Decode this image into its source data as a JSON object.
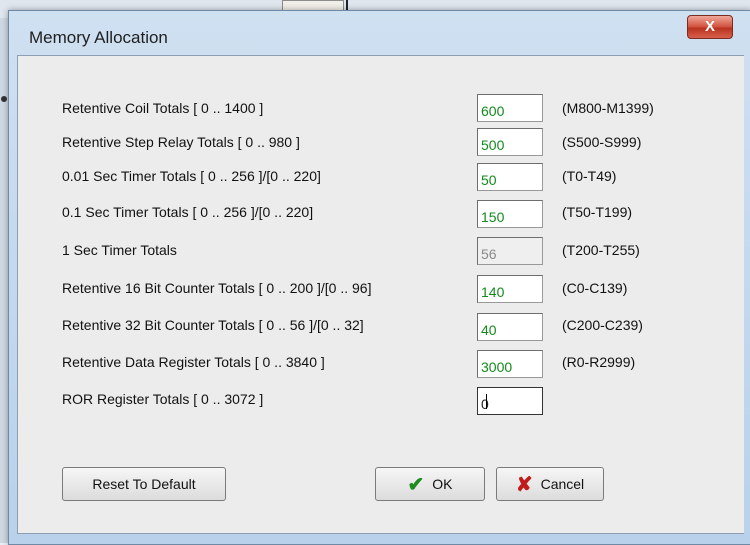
{
  "window": {
    "title": "Memory Allocation",
    "close_label": "X"
  },
  "rows": [
    {
      "label": "Retentive Coil Totals [ 0 .. 1400 ]",
      "value": "600",
      "range": "(M800-M1399)"
    },
    {
      "label": "Retentive Step Relay Totals [ 0 .. 980 ]",
      "value": "500",
      "range": "(S500-S999)"
    },
    {
      "label": "0.01 Sec Timer Totals [ 0 .. 256 ]/[0 .. 220]",
      "value": "50",
      "range": "(T0-T49)"
    },
    {
      "label": "0.1 Sec Timer Totals [ 0 .. 256 ]/[0 .. 220]",
      "value": "150",
      "range": "(T50-T199)"
    },
    {
      "label": "1 Sec Timer Totals",
      "value": "56",
      "range": "(T200-T255)"
    },
    {
      "label": "Retentive 16 Bit Counter Totals [ 0 .. 200 ]/[0 .. 96]",
      "value": "140",
      "range": "(C0-C139)"
    },
    {
      "label": "Retentive 32 Bit Counter Totals [ 0 .. 56 ]/[0 .. 32]",
      "value": "40",
      "range": "(C200-C239)"
    },
    {
      "label": "Retentive Data Register Totals [ 0 .. 3840 ]",
      "value": "3000",
      "range": "(R0-R2999)"
    },
    {
      "label": "ROR Register Totals [ 0 .. 3072 ]",
      "value": "0",
      "range": ""
    }
  ],
  "buttons": {
    "reset": "Reset To Default",
    "ok": "OK",
    "cancel": "Cancel"
  },
  "icons": {
    "ok": "checkmark-icon",
    "cancel": "cross-icon"
  },
  "colors": {
    "field_text": "#138a1d",
    "disabled_text": "#8a8a8a"
  }
}
